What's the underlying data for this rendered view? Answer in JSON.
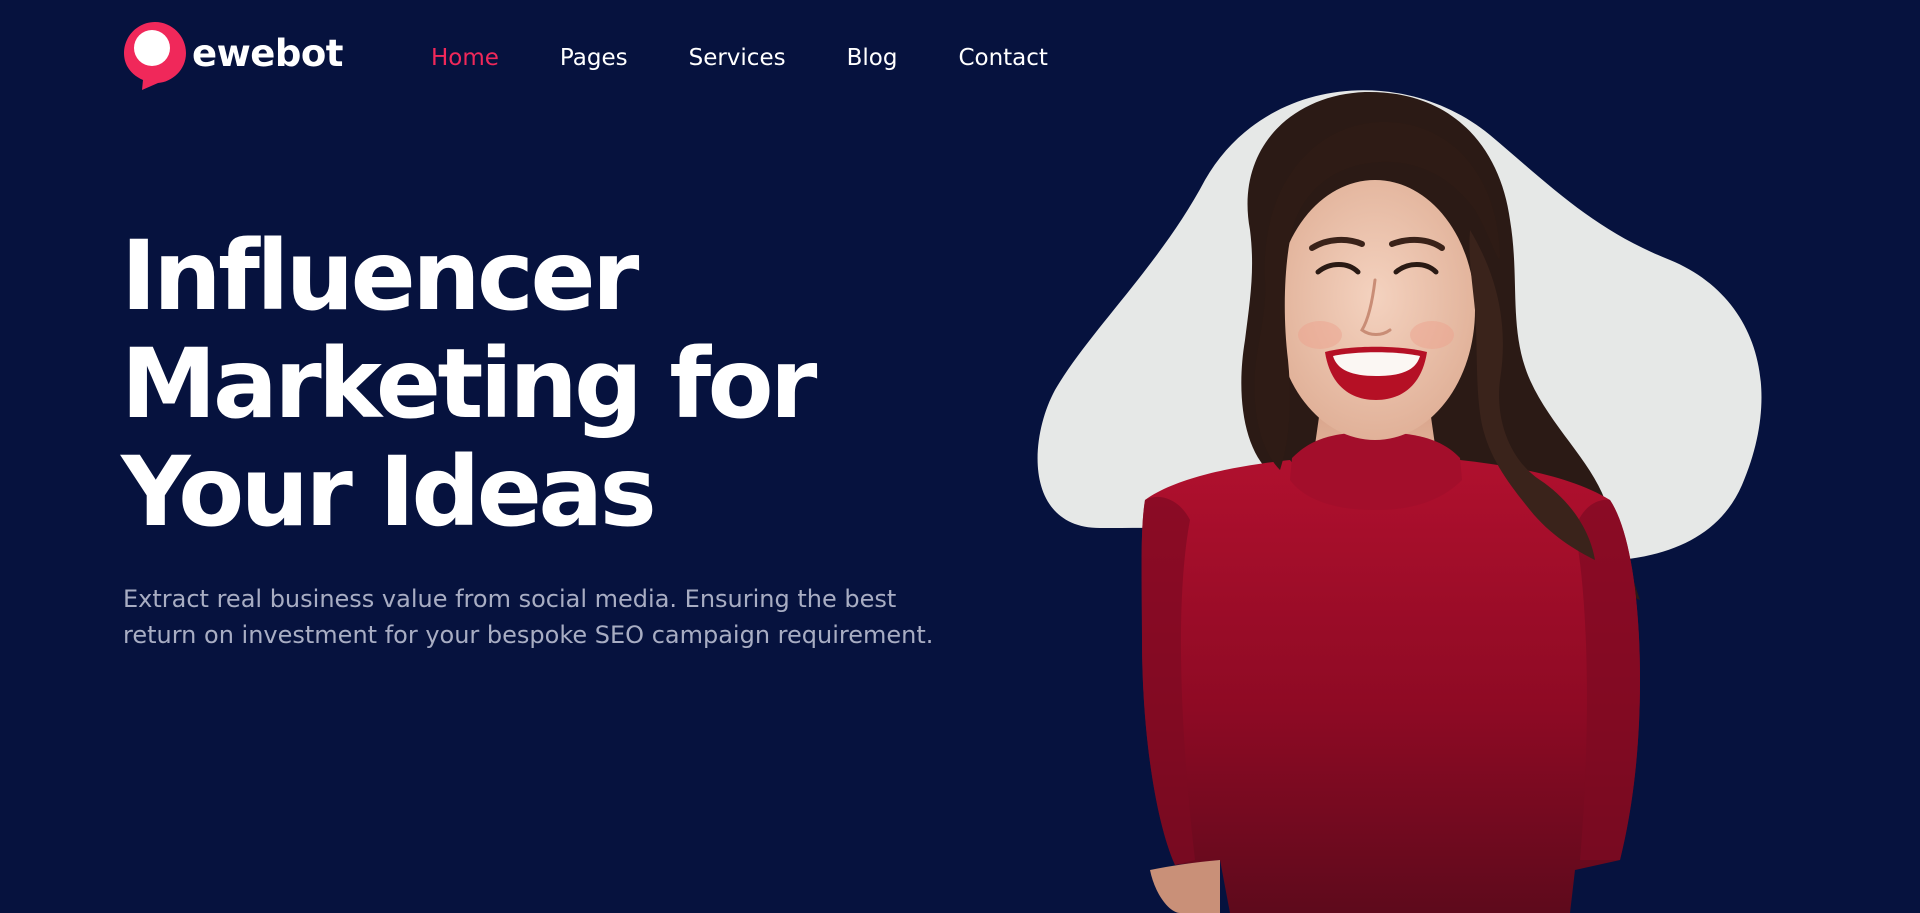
{
  "brand": {
    "name": "ewebot",
    "accent_color": "#f0285a",
    "logo_icon": "speech-bubble-icon"
  },
  "nav": {
    "items": [
      {
        "label": "Home",
        "active": true
      },
      {
        "label": "Pages",
        "active": false
      },
      {
        "label": "Services",
        "active": false
      },
      {
        "label": "Blog",
        "active": false
      },
      {
        "label": "Contact",
        "active": false
      }
    ]
  },
  "hero": {
    "title_lines": [
      "Influencer",
      "Marketing for",
      "Your Ideas"
    ],
    "subtitle": "Extract real business value from social media. Ensuring the best return on investment for your bespoke SEO campaign requirement.",
    "image": "smiling-woman-in-red-top-photo",
    "background_color": "#06123e",
    "blob_color": "#e6e8e7"
  }
}
